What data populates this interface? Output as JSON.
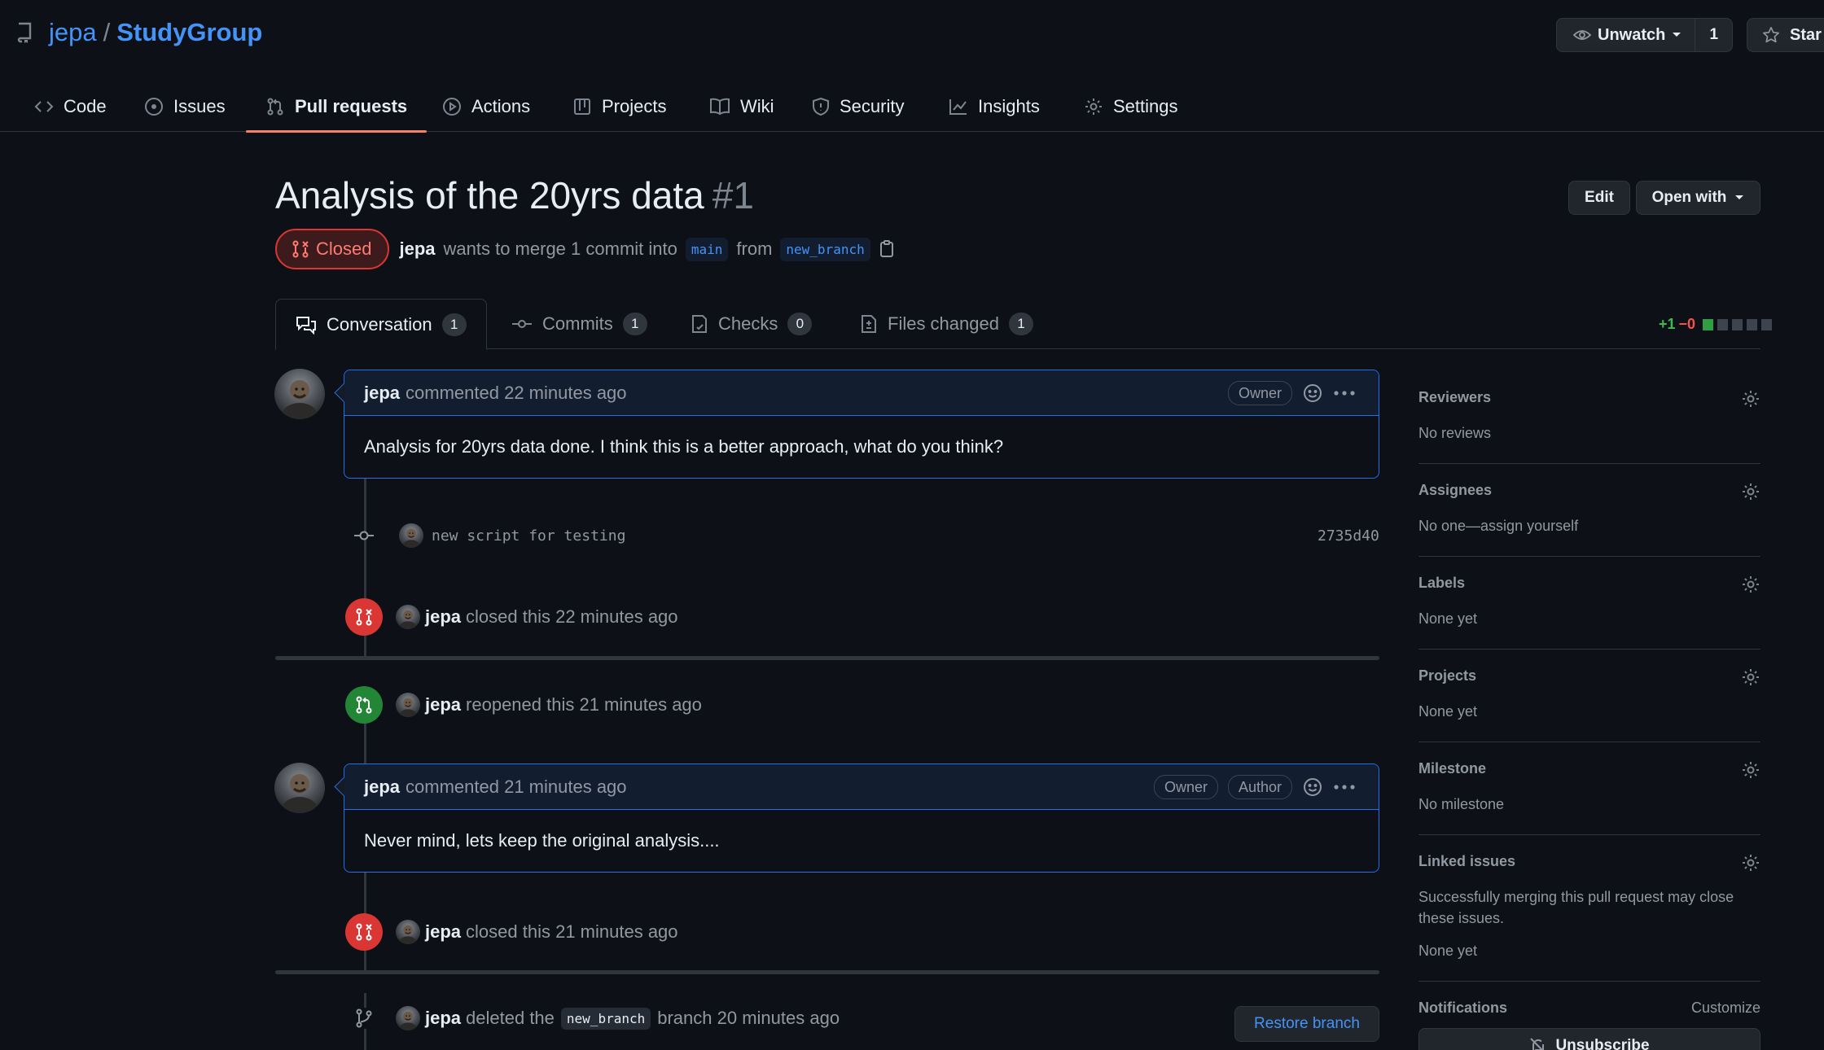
{
  "repo": {
    "owner": "jepa",
    "separator": "/",
    "name": "StudyGroup"
  },
  "header": {
    "watch_label": "Unwatch",
    "watch_count": "1",
    "star_label": "Star"
  },
  "nav": {
    "code": "Code",
    "issues": "Issues",
    "pull_requests": "Pull requests",
    "actions": "Actions",
    "projects": "Projects",
    "wiki": "Wiki",
    "security": "Security",
    "insights": "Insights",
    "settings": "Settings"
  },
  "pr": {
    "title": "Analysis of the 20yrs data",
    "number": "#1",
    "edit_label": "Edit",
    "open_with_label": "Open with",
    "state": "Closed",
    "author": "jepa",
    "merge_text": "wants to merge 1 commit into",
    "base_branch": "main",
    "from_text": "from",
    "head_branch": "new_branch"
  },
  "tabs": {
    "conversation": {
      "label": "Conversation",
      "count": "1"
    },
    "commits": {
      "label": "Commits",
      "count": "1"
    },
    "checks": {
      "label": "Checks",
      "count": "0"
    },
    "files": {
      "label": "Files changed",
      "count": "1"
    }
  },
  "diffstat": {
    "additions": "+1",
    "deletions": "−0"
  },
  "timeline": {
    "comment1": {
      "author": "jepa",
      "meta": "commented 22 minutes ago",
      "role": "Owner",
      "body": "Analysis for 20yrs data done. I think this is a better approach, what do you think?"
    },
    "commit": {
      "message": "new script for testing",
      "sha": "2735d40"
    },
    "closed1": {
      "author": "jepa",
      "text": "closed this 22 minutes ago"
    },
    "reopened": {
      "author": "jepa",
      "text": "reopened this 21 minutes ago"
    },
    "comment2": {
      "author": "jepa",
      "meta": "commented 21 minutes ago",
      "role1": "Owner",
      "role2": "Author",
      "body": "Never mind, lets keep the original analysis...."
    },
    "closed2": {
      "author": "jepa",
      "text": "closed this 21 minutes ago"
    },
    "deleted": {
      "author": "jepa",
      "text_before": "deleted the",
      "branch": "new_branch",
      "text_after": "branch 20 minutes ago",
      "restore_label": "Restore branch"
    }
  },
  "sidebar": {
    "reviewers": {
      "title": "Reviewers",
      "value": "No reviews"
    },
    "assignees": {
      "title": "Assignees",
      "value": "No one—assign yourself"
    },
    "labels": {
      "title": "Labels",
      "value": "None yet"
    },
    "projects": {
      "title": "Projects",
      "value": "None yet"
    },
    "milestone": {
      "title": "Milestone",
      "value": "No milestone"
    },
    "linked": {
      "title": "Linked issues",
      "desc": "Successfully merging this pull request may close these issues.",
      "value": "None yet"
    },
    "notifications": {
      "title": "Notifications",
      "customize": "Customize",
      "unsubscribe": "Unsubscribe"
    }
  },
  "colors": {
    "accent": "#4493f8",
    "closed": "#da3633",
    "open": "#238636",
    "underline": "#f78166",
    "background": "#0d1117"
  }
}
